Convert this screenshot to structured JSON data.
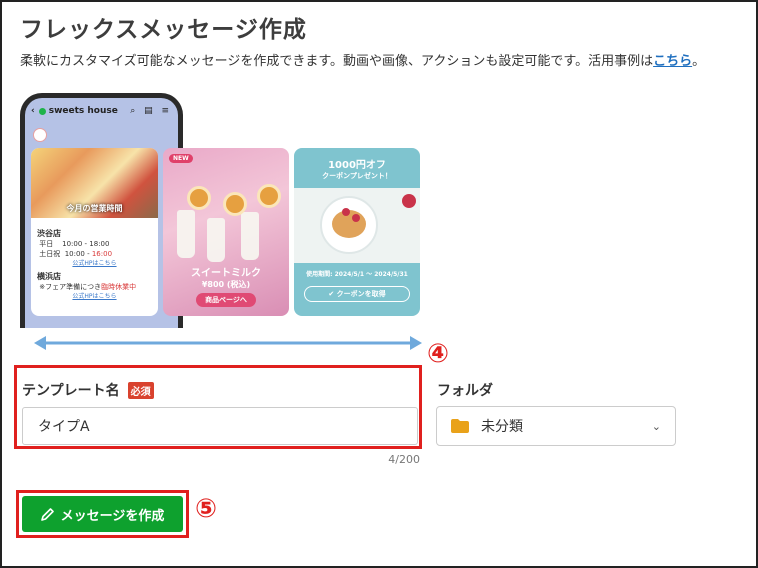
{
  "page": {
    "title": "フレックスメッセージ作成",
    "description": "柔軟にカスタマイズ可能なメッセージを作成できます。動画や画像、アクションも設定可能です。活用事例は",
    "description_link": "こちら",
    "description_end": "。"
  },
  "preview": {
    "account_name": "sweets house",
    "card1": {
      "caption": "今月の営業時間",
      "store1_name": "渋谷店",
      "row1_label": "平日",
      "row1_time": "10:00 - 18:00",
      "row2_label": "土日祝",
      "row2_time_a": "10:00 - ",
      "row2_time_b": "16:00",
      "link1": "公式HPはこちら",
      "store2_name": "横浜店",
      "notice_a": "※フェア準備につき",
      "notice_b": "臨時休業中",
      "link2": "公式HPはこちら"
    },
    "card2": {
      "badge": "NEW",
      "name": "スイートミルク",
      "price": "¥800 (税込)",
      "button": "商品ページへ"
    },
    "card3": {
      "title": "1000円オフ",
      "subtitle": "クーポンプレゼント！",
      "period": "使用期間: 2024/5/1 〜 2024/5/31",
      "button": "✔ クーポンを取得"
    }
  },
  "annotations": {
    "step4": "④",
    "step5": "⑤"
  },
  "form": {
    "template_label": "テンプレート名",
    "required_badge": "必須",
    "template_value": "タイプA",
    "char_counter": "4/200",
    "folder_label": "フォルダ",
    "folder_value": "未分類"
  },
  "actions": {
    "create_label": "メッセージを作成"
  },
  "colors": {
    "accent_green": "#0ea12e",
    "annotation_red": "#e0201e",
    "link_blue": "#1f6fbf",
    "folder_orange": "#e9a21a"
  }
}
